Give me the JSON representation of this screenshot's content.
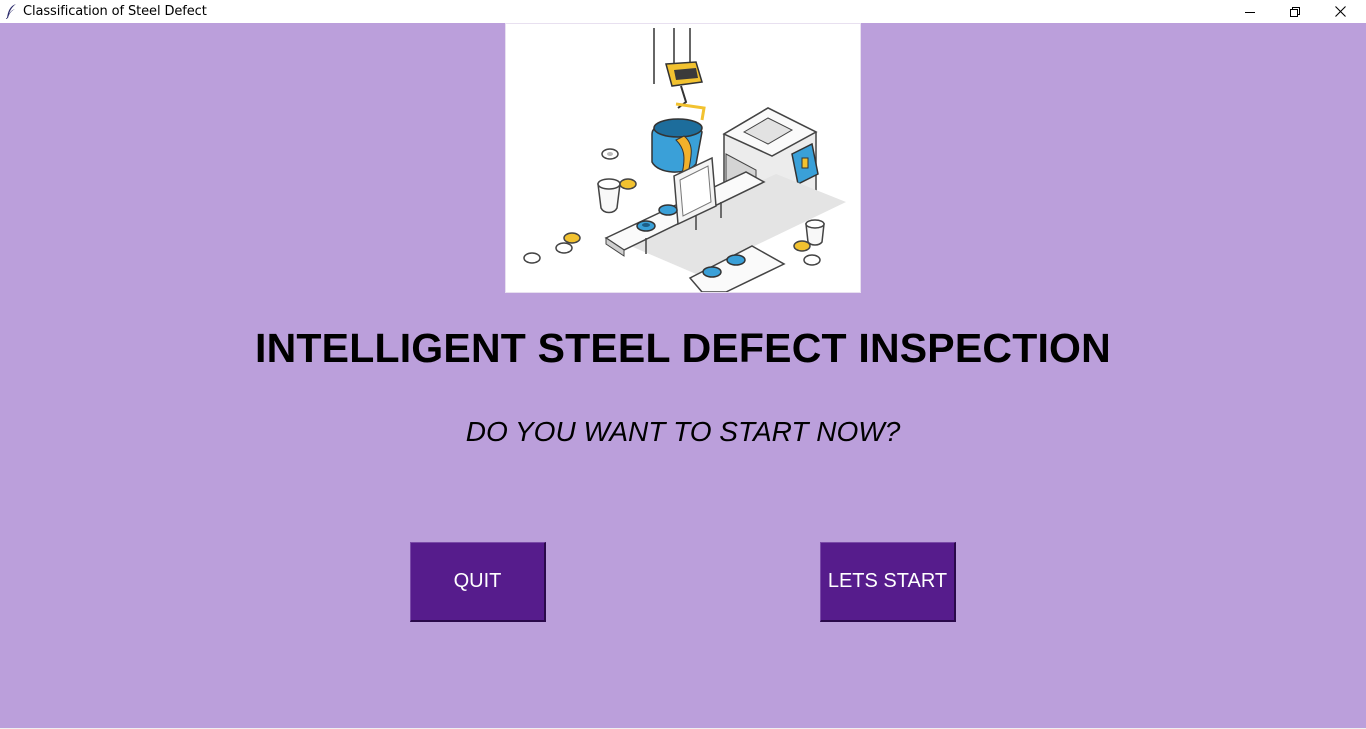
{
  "window": {
    "title": "Classification of Steel Defect",
    "icon": "feather-icon",
    "controls": [
      "minimize-icon",
      "restore-icon",
      "close-icon"
    ]
  },
  "main": {
    "heading": "INTELLIGENT STEEL DEFECT INSPECTION",
    "subheading": "DO YOU WANT TO START NOW?",
    "hero_image": "steel-production-line-illustration"
  },
  "buttons": {
    "quit_label": "QUIT",
    "start_label": "LETS START"
  },
  "colors": {
    "background": "#BB9FDB",
    "button": "#561C8C",
    "button_text": "#FFFFFF",
    "text": "#000000"
  }
}
